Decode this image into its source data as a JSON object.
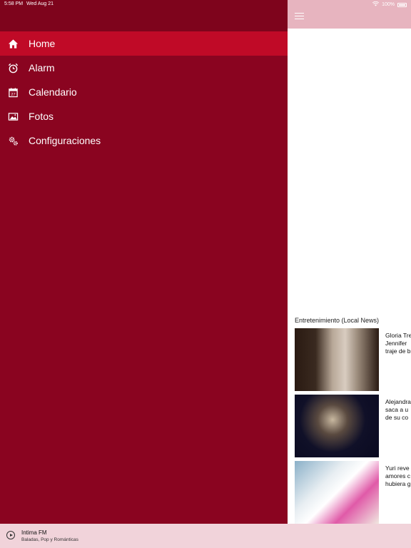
{
  "status_bar": {
    "time": "5:58 PM",
    "date": "Wed Aug 21",
    "battery": "100%"
  },
  "drawer": {
    "items": [
      {
        "label": "Home",
        "icon": "home-icon",
        "active": true
      },
      {
        "label": "Alarm",
        "icon": "alarm-clock-icon",
        "active": false
      },
      {
        "label": "Calendario",
        "icon": "calendar-icon",
        "active": false
      },
      {
        "label": "Fotos",
        "icon": "photos-icon",
        "active": false
      },
      {
        "label": "Configuraciones",
        "icon": "settings-gears-icon",
        "active": false
      }
    ]
  },
  "main": {
    "section_title": "Entretenimiento (Local News)",
    "news": [
      {
        "headline": "Gloria Tre\nJennifer\ntraje de b"
      },
      {
        "headline": "Alejandra\nsaca a u\nde su co"
      },
      {
        "headline": "Yuri reve\namores c\nhubiera g"
      }
    ]
  },
  "player": {
    "station": "Intima FM",
    "subtitle": "Baladas, Pop y Románticas"
  },
  "colors": {
    "drawer_bg": "#8a0420",
    "active_item": "#c00a27",
    "topbar": "#e7b4bf",
    "player_bg": "#f1d3da"
  }
}
